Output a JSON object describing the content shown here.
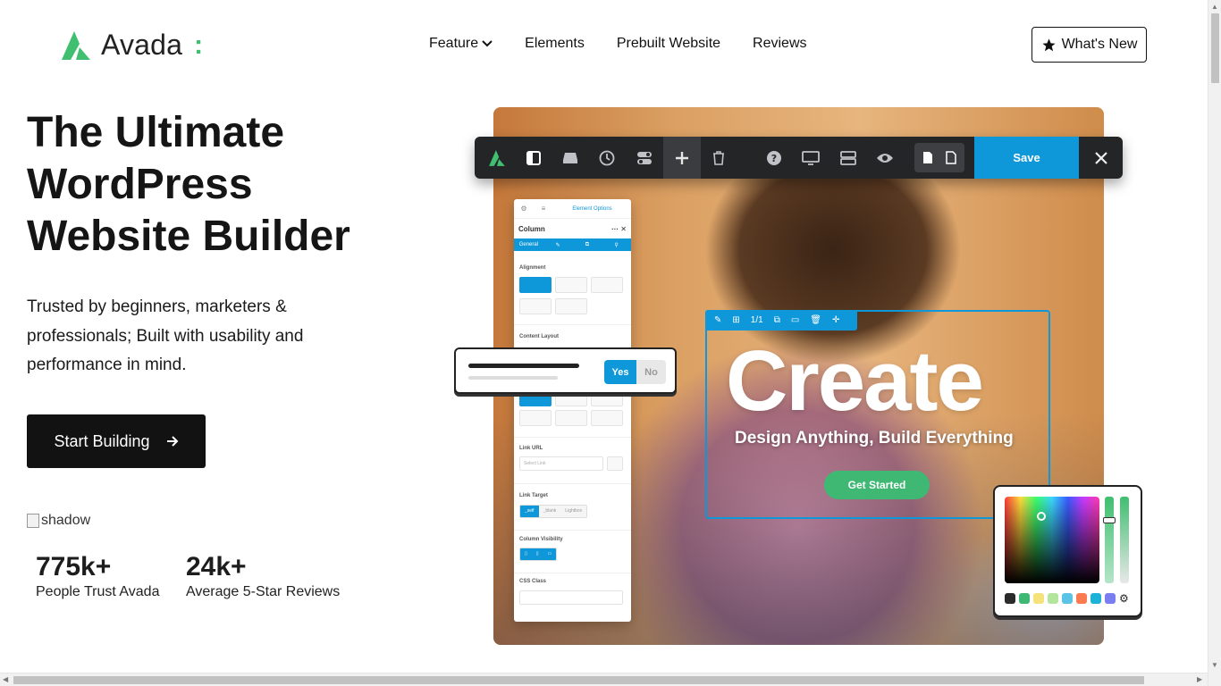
{
  "header": {
    "logo_text": "Avada",
    "nav": [
      {
        "label": "Feature"
      },
      {
        "label": "Elements"
      },
      {
        "label": "Prebuilt Website"
      },
      {
        "label": "Reviews"
      }
    ],
    "whats_new_label": "What's New"
  },
  "hero": {
    "title": "The Ultimate WordPress Website Builder",
    "subtitle": "Trusted by beginners, marketers & professionals; Built with usability and performance in mind.",
    "cta_label": "Start Building",
    "shadow_alt": "shadow",
    "stats": [
      {
        "number": "775k+",
        "label": "People Trust Avada"
      },
      {
        "number": "24k+",
        "label": "Average 5-Star Reviews"
      }
    ]
  },
  "builder": {
    "save_label": "Save",
    "panel": {
      "tab_label": "Element Options",
      "title": "Column",
      "sub_tabs": [
        "General"
      ],
      "sections": {
        "alignment": "Alignment",
        "content_layout": "Content Layout",
        "link_url": "Link URL",
        "link_url_placeholder": "Select Link",
        "link_target": "Link Target",
        "link_target_options": [
          "_self",
          "_blank",
          "Lightbox"
        ],
        "column_visibility": "Column Visibility",
        "css_class": "CSS Class"
      }
    },
    "toggle": {
      "yes": "Yes",
      "no": "No"
    },
    "create_bar_label": "1/1",
    "create_word": "Create",
    "create_tagline": "Design Anything, Build Everything",
    "get_started_label": "Get Started",
    "swatch_colors": [
      "#2b2b2b",
      "#3fb874",
      "#f6e27a",
      "#b4e59c",
      "#5bc4e6",
      "#f97b4f",
      "#1eb2d8",
      "#7b7ef0"
    ]
  },
  "colors": {
    "accent": "#0e97d9",
    "brand_green": "#3fbf6f",
    "dark": "#121212"
  }
}
